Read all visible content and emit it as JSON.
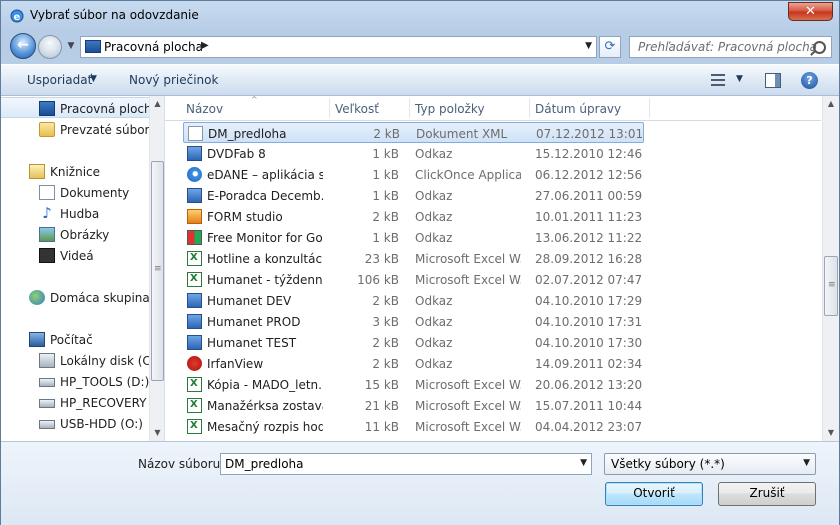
{
  "window": {
    "title": "Vybrať súbor na odovzdanie",
    "close_symbol": "✕"
  },
  "nav": {
    "back_symbol": "←",
    "forward_symbol": "→",
    "recent_symbol": "▼",
    "address": "Pracovná plocha",
    "address_sep": "▶",
    "address_drop": "▼",
    "refresh_symbol": "⟳",
    "search_placeholder": "Prehľadávať: Pracovná plocha"
  },
  "toolbar": {
    "organize": "Usporiadať",
    "organize_arrow": "▼",
    "new_folder": "Nový priečinok",
    "view_arrow": "▼",
    "help_symbol": "?"
  },
  "sidebar": {
    "items": [
      {
        "label": "Pracovná plocha",
        "icon": "desktop-icon"
      },
      {
        "label": "Prevzaté súbory",
        "icon": "downloads-icon"
      },
      {
        "label": "Knižnice",
        "icon": "libraries-icon"
      },
      {
        "label": "Dokumenty",
        "icon": "documents-icon"
      },
      {
        "label": "Hudba",
        "icon": "music-icon"
      },
      {
        "label": "Obrázky",
        "icon": "pictures-icon"
      },
      {
        "label": "Videá",
        "icon": "videos-icon"
      },
      {
        "label": "Domáca skupina",
        "icon": "homegroup-icon"
      },
      {
        "label": "Počítač",
        "icon": "computer-icon"
      },
      {
        "label": "Lokálny disk (C:)",
        "icon": "local-disk-icon"
      },
      {
        "label": "HP_TOOLS (D:)",
        "icon": "drive-icon"
      },
      {
        "label": "HP_RECOVERY (E",
        "icon": "drive-icon"
      },
      {
        "label": "USB-HDD (O:)",
        "icon": "drive-icon"
      }
    ],
    "scroll_up": "▲",
    "scroll_down": "▼",
    "grip": "≡"
  },
  "columns": {
    "name": "Názov",
    "size": "Veľkosť",
    "type": "Typ položky",
    "date": "Dátum úpravy",
    "sort_symbol": "^"
  },
  "files": [
    {
      "name": "DM_predloha",
      "size": "2 kB",
      "type": "Dokument XML",
      "date": "07.12.2012 13:01",
      "icon": "xml-file-icon"
    },
    {
      "name": "DVDFab 8",
      "size": "1 kB",
      "type": "Odkaz",
      "date": "15.12.2010 12:46",
      "icon": "shortcut-icon"
    },
    {
      "name": "eDANE – aplikácia s...",
      "size": "1 kB",
      "type": "ClickOnce Applica...",
      "date": "06.12.2012 12:56",
      "icon": "ie-icon"
    },
    {
      "name": "E-Poradca Decemb...",
      "size": "1 kB",
      "type": "Odkaz",
      "date": "27.06.2011 00:59",
      "icon": "shortcut-icon"
    },
    {
      "name": "FORM studio",
      "size": "2 kB",
      "type": "Odkaz",
      "date": "10.01.2011 11:23",
      "icon": "orange-app-icon"
    },
    {
      "name": "Free Monitor for Go...",
      "size": "1 kB",
      "type": "Odkaz",
      "date": "13.06.2012 11:22",
      "icon": "multicolor-app-icon"
    },
    {
      "name": "Hotline a konzultáci...",
      "size": "23 kB",
      "type": "Microsoft Excel W...",
      "date": "28.09.2012 16:28",
      "icon": "excel-icon"
    },
    {
      "name": "Humanet - týždenn...",
      "size": "106 kB",
      "type": "Microsoft Excel W...",
      "date": "02.07.2012 07:47",
      "icon": "excel-icon"
    },
    {
      "name": "Humanet DEV",
      "size": "2 kB",
      "type": "Odkaz",
      "date": "04.10.2010 17:29",
      "icon": "shortcut-icon"
    },
    {
      "name": "Humanet PROD",
      "size": "3 kB",
      "type": "Odkaz",
      "date": "04.10.2010 17:31",
      "icon": "shortcut-icon"
    },
    {
      "name": "Humanet TEST",
      "size": "2 kB",
      "type": "Odkaz",
      "date": "04.10.2010 17:30",
      "icon": "shortcut-icon"
    },
    {
      "name": "IrfanView",
      "size": "2 kB",
      "type": "Odkaz",
      "date": "14.09.2011 02:34",
      "icon": "irfanview-icon"
    },
    {
      "name": "Kópia - MADO_letn...",
      "size": "15 kB",
      "type": "Microsoft Excel W...",
      "date": "20.06.2012 13:20",
      "icon": "excel-icon"
    },
    {
      "name": "Manažérksa zostava...",
      "size": "21 kB",
      "type": "Microsoft Excel W...",
      "date": "15.07.2011 10:44",
      "icon": "excel-icon"
    },
    {
      "name": "Mesačný rozpis hod...",
      "size": "11 kB",
      "type": "Microsoft Excel W...",
      "date": "04.04.2012 23:07",
      "icon": "excel-icon"
    }
  ],
  "files_scroll": {
    "up": "▲",
    "down": "▼",
    "grip": "≡"
  },
  "bottom": {
    "filename_label": "Názov súboru:",
    "filename_value": "DM_predloha",
    "filename_drop": "▼",
    "filetype_value": "Všetky súbory (*.*)",
    "filetype_drop": "▼",
    "open_label": "Otvoriť",
    "cancel_label": "Zrušiť"
  },
  "colors": {
    "accent": "#3c7fb1",
    "selection": "#cfe2f7",
    "title_bar": "#c8dcf0",
    "close": "#c5321b"
  }
}
